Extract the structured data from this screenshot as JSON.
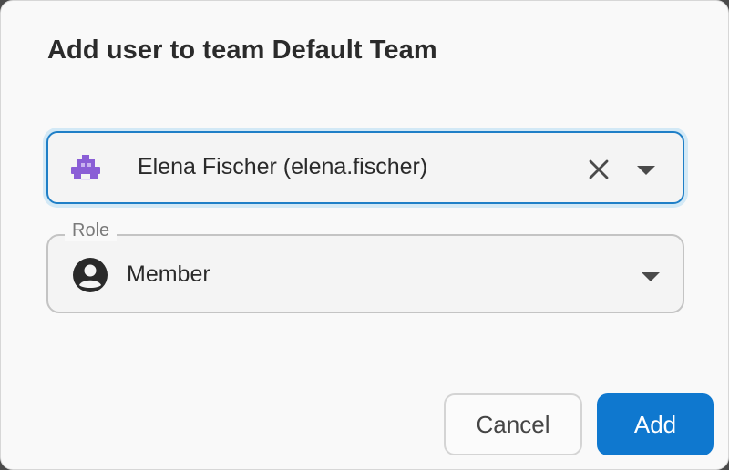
{
  "dialog": {
    "title": "Add user to team Default Team"
  },
  "user_select": {
    "value": "Elena Fischer (elena.fischer)",
    "avatar_icon": "robot-avatar-icon",
    "avatar_color": "#8a5ed6",
    "clear_icon": "close-icon",
    "dropdown_icon": "triangle-down-icon"
  },
  "role_select": {
    "label": "Role",
    "value": "Member",
    "icon": "account-circle-icon",
    "dropdown_icon": "triangle-down-icon"
  },
  "actions": {
    "cancel_label": "Cancel",
    "add_label": "Add"
  },
  "colors": {
    "accent": "#0f78cf",
    "focus_ring": "#d3e9f6"
  }
}
